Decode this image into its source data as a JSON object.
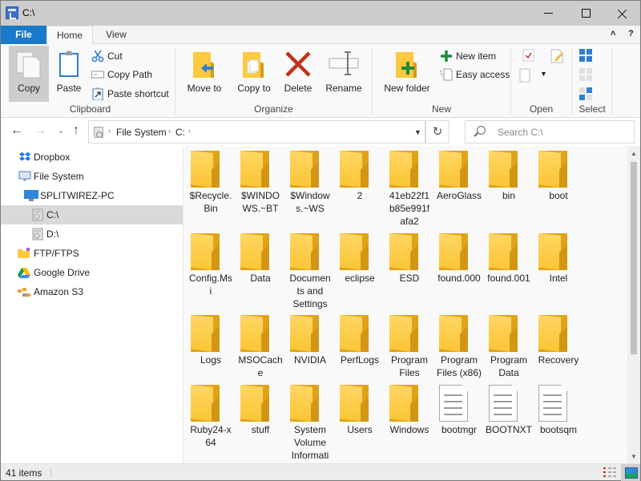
{
  "window": {
    "title": "C:\\",
    "controls": {
      "minimize": "minimize",
      "maximize": "maximize",
      "close": "close"
    }
  },
  "ribbon": {
    "tabs": [
      {
        "label": "File",
        "active": false
      },
      {
        "label": "Home",
        "active": true
      },
      {
        "label": "View",
        "active": false
      }
    ],
    "collapse_glyph": "˄",
    "help_glyph": "?",
    "groups": {
      "clipboard": {
        "label": "Clipboard",
        "copy": "Copy",
        "paste": "Paste",
        "cut": "Cut",
        "copy_path": "Copy Path",
        "paste_shortcut": "Paste shortcut"
      },
      "organize": {
        "label": "Organize",
        "move_to": "Move to",
        "copy_to": "Copy to",
        "delete": "Delete",
        "rename": "Rename"
      },
      "new": {
        "label": "New",
        "new_folder": "New folder",
        "new_item": "New item",
        "easy_access": "Easy access"
      },
      "open": {
        "label": "Open"
      },
      "select": {
        "label": "Select"
      }
    },
    "colors": {
      "file_tab": "#1979ca",
      "delete_red": "#c1311b",
      "new_green": "#1e8a3c",
      "select_blue": "#2d7fcf"
    }
  },
  "navigation": {
    "back_glyph": "←",
    "forward_glyph": "→",
    "recent_glyph": "⌄",
    "up_glyph": "↑",
    "breadcrumb": [
      "File System",
      "C:"
    ],
    "breadcrumb_sep": "›",
    "dropdown_glyph": "▼",
    "refresh_glyph": "↻",
    "search_placeholder": "Search C:\\"
  },
  "sidebar": {
    "items": [
      {
        "label": "Dropbox",
        "icon": "dropbox-icon",
        "level": 0,
        "selected": false
      },
      {
        "label": "File System",
        "icon": "monitor-icon",
        "level": 0,
        "selected": false
      },
      {
        "label": "SPLITWIREZ-PC",
        "icon": "computer-icon",
        "level": 1,
        "selected": false
      },
      {
        "label": "C:\\",
        "icon": "drive-icon",
        "level": 2,
        "selected": true
      },
      {
        "label": "D:\\",
        "icon": "drive-icon",
        "level": 2,
        "selected": false
      },
      {
        "label": "FTP/FTPS",
        "icon": "ftp-folder-icon",
        "level": 0,
        "selected": false
      },
      {
        "label": "Google Drive",
        "icon": "google-drive-icon",
        "level": 0,
        "selected": false
      },
      {
        "label": "Amazon S3",
        "icon": "amazon-s3-icon",
        "level": 0,
        "selected": false
      }
    ]
  },
  "files": [
    {
      "name": "$Recycle.Bin",
      "lines": [
        "$Recycle.",
        "Bin"
      ],
      "type": "folder"
    },
    {
      "name": "$WINDOWS.~BT",
      "lines": [
        "$WINDO",
        "WS.~BT"
      ],
      "type": "folder"
    },
    {
      "name": "$Windows.~WS",
      "lines": [
        "$Window",
        "s.~WS"
      ],
      "type": "folder"
    },
    {
      "name": "2",
      "lines": [
        "2"
      ],
      "type": "folder"
    },
    {
      "name": "41eb22f1b85e991fafa2",
      "lines": [
        "41eb22f1",
        "b85e991f",
        "afa2"
      ],
      "type": "folder"
    },
    {
      "name": "AeroGlass",
      "lines": [
        "AeroGlass"
      ],
      "type": "folder"
    },
    {
      "name": "bin",
      "lines": [
        "bin"
      ],
      "type": "folder"
    },
    {
      "name": "boot",
      "lines": [
        "boot"
      ],
      "type": "folder"
    },
    {
      "name": "Config.Msi",
      "lines": [
        "Config.Ms",
        "i"
      ],
      "type": "folder"
    },
    {
      "name": "Data",
      "lines": [
        "Data"
      ],
      "type": "folder"
    },
    {
      "name": "Documents and Settings",
      "lines": [
        "Documen",
        "ts and",
        "Settings"
      ],
      "type": "folder"
    },
    {
      "name": "eclipse",
      "lines": [
        "eclipse"
      ],
      "type": "folder"
    },
    {
      "name": "ESD",
      "lines": [
        "ESD"
      ],
      "type": "folder"
    },
    {
      "name": "found.000",
      "lines": [
        "found.000"
      ],
      "type": "folder"
    },
    {
      "name": "found.001",
      "lines": [
        "found.001"
      ],
      "type": "folder"
    },
    {
      "name": "Intel",
      "lines": [
        "Intel"
      ],
      "type": "folder"
    },
    {
      "name": "Logs",
      "lines": [
        "Logs"
      ],
      "type": "folder"
    },
    {
      "name": "MSOCache",
      "lines": [
        "MSOCach",
        "e"
      ],
      "type": "folder"
    },
    {
      "name": "NVIDIA",
      "lines": [
        "NVIDIA"
      ],
      "type": "folder"
    },
    {
      "name": "PerfLogs",
      "lines": [
        "PerfLogs"
      ],
      "type": "folder"
    },
    {
      "name": "Program Files",
      "lines": [
        "Program",
        "Files"
      ],
      "type": "folder"
    },
    {
      "name": "Program Files (x86)",
      "lines": [
        "Program",
        "Files (x86)"
      ],
      "type": "folder"
    },
    {
      "name": "Program Data",
      "lines": [
        "Program",
        "Data"
      ],
      "type": "folder"
    },
    {
      "name": "Recovery",
      "lines": [
        "Recovery"
      ],
      "type": "folder"
    },
    {
      "name": "Ruby24-x64",
      "lines": [
        "Ruby24-x",
        "64"
      ],
      "type": "folder"
    },
    {
      "name": "stuff",
      "lines": [
        "stuff"
      ],
      "type": "folder"
    },
    {
      "name": "System Volume Information",
      "lines": [
        "System",
        "Volume",
        "Informati",
        "on"
      ],
      "type": "folder"
    },
    {
      "name": "Users",
      "lines": [
        "Users"
      ],
      "type": "folder"
    },
    {
      "name": "Windows",
      "lines": [
        "Windows"
      ],
      "type": "folder"
    },
    {
      "name": "bootmgr",
      "lines": [
        "bootmgr"
      ],
      "type": "file"
    },
    {
      "name": "BOOTNXT",
      "lines": [
        "BOOTNXT"
      ],
      "type": "file"
    },
    {
      "name": "bootsqm",
      "lines": [
        "bootsqm"
      ],
      "type": "file"
    }
  ],
  "status": {
    "item_count": "41 items"
  },
  "scroll": {
    "position_fraction": 0.0
  }
}
